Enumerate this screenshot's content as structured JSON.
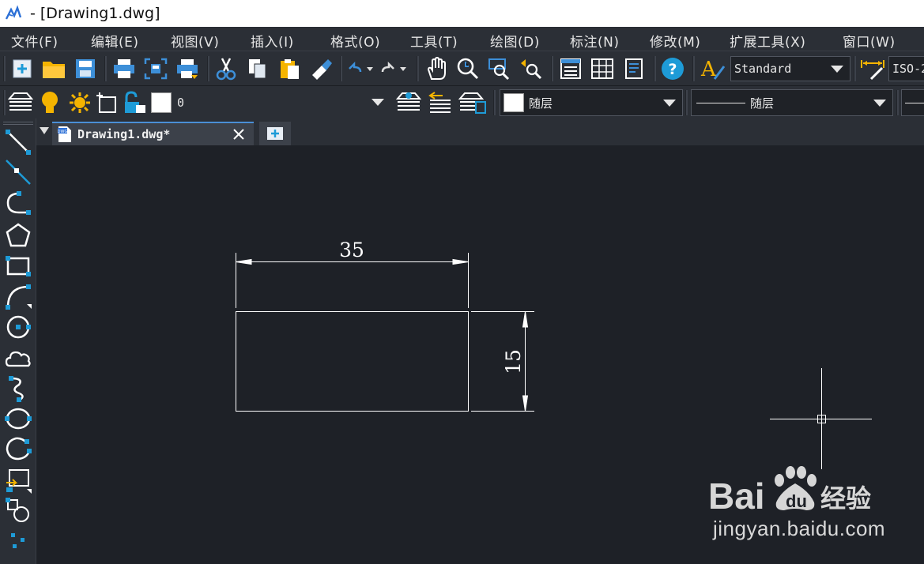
{
  "window": {
    "title": "- [Drawing1.dwg]"
  },
  "menu": [
    "文件(F)",
    "编辑(E)",
    "视图(V)",
    "插入(I)",
    "格式(O)",
    "工具(T)",
    "绘图(D)",
    "标注(N)",
    "修改(M)",
    "扩展工具(X)",
    "窗口(W)"
  ],
  "toolbar": {
    "text_style": "Standard",
    "dim_style": "ISO-2",
    "layer_name": "0",
    "color_value": "随层",
    "linetype_value": "随层"
  },
  "tabs": [
    {
      "label": "Drawing1.dwg*"
    }
  ],
  "drawing": {
    "dim_horizontal": "35",
    "dim_vertical": "15"
  },
  "watermark": {
    "url": "jingyan.baidu.com"
  },
  "colors": {
    "background": "#1e2127",
    "toolbar": "#2b2f36",
    "accent": "#1e9bd7",
    "icon_yellow": "#f5b400",
    "line": "#ffffff"
  }
}
